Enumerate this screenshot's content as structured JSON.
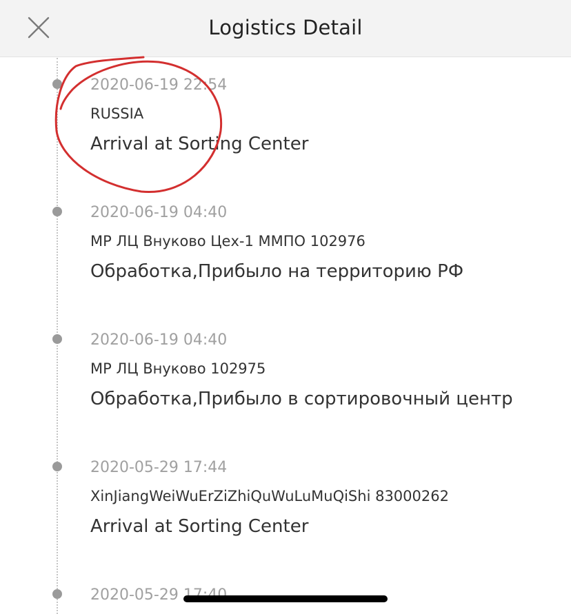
{
  "header": {
    "title": "Logistics Detail",
    "close_icon": "close-icon"
  },
  "events": [
    {
      "time": "2020-06-19 22:54",
      "location": "RUSSIA",
      "status": "Arrival at Sorting Center"
    },
    {
      "time": "2020-06-19 04:40",
      "location": "МР ЛЦ Внуково Цех-1 ММПО 102976",
      "status": "Обработка,Прибыло на территорию РФ"
    },
    {
      "time": "2020-06-19 04:40",
      "location": "МР ЛЦ Внуково 102975",
      "status": "Обработка,Прибыло в сортировочный центр"
    },
    {
      "time": "2020-05-29 17:44",
      "location": "XinJiangWeiWuErZiZhiQuWuLuMuQiShi 83000262",
      "status": "Arrival at Sorting Center"
    },
    {
      "time": "2020-05-29 17:40",
      "location": "",
      "status": ""
    }
  ],
  "colors": {
    "header_bg": "#f3f3f3",
    "dot": "#9a9a9a",
    "time_text": "#a0a0a0",
    "body_text": "#333333",
    "annotation_circle": "#d32f2f"
  }
}
